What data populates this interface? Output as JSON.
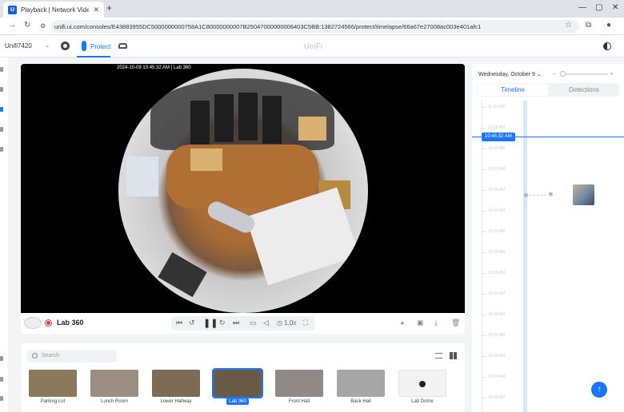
{
  "browser": {
    "tab_title": "Playback | Network Video Reco",
    "url": "unifi.ui.com/consoles/E43883955DC5000000000758A1C80000000007B25047000000006403C5BB:1382724566/protect/timelapse/66a67e27008ac003e401afc1"
  },
  "appbar": {
    "console_name": "Unifi7420",
    "product_label": "Protect",
    "logo": "UniFi"
  },
  "player": {
    "overlay_timestamp": "2024-10-09 10:45:32 AM | Lab 360",
    "camera_name": "Lab 360",
    "speed": "1.0x"
  },
  "timeline": {
    "date": "Wednesday, October 9",
    "tabs": [
      "Timeline",
      "Detections"
    ],
    "current_time": "10:45:32 AM",
    "hour_labels": [
      "11:00 AM",
      "10:00 AM",
      "10:00 AM",
      "10:00 AM",
      "10:00 AM",
      "10:00 AM",
      "10:00 AM",
      "10:00 AM",
      "10:00 AM",
      "10:00 AM",
      "10:00 AM",
      "10:00 AM",
      "10:00 AM",
      "10:00 AM",
      "10:00 AM"
    ]
  },
  "cameras": {
    "search_placeholder": "Search",
    "items": [
      {
        "label": "Parking Lot",
        "color": "#8a7a5a",
        "selected": false
      },
      {
        "label": "Lunch Room",
        "color": "#9a8f80",
        "selected": false
      },
      {
        "label": "Lower Hallway",
        "color": "#7d6a55",
        "selected": false
      },
      {
        "label": "Lab 360",
        "color": "#6a5a48",
        "selected": true
      },
      {
        "label": "Front Hall",
        "color": "#8f8a86",
        "selected": false
      },
      {
        "label": "Back Hall",
        "color": "#a6a6a6",
        "selected": false
      },
      {
        "label": "Lab Dome",
        "color": "#f3f3f3",
        "selected": false
      }
    ]
  },
  "colors": {
    "accent": "#1a75ff",
    "recording": "#e23b3b"
  }
}
